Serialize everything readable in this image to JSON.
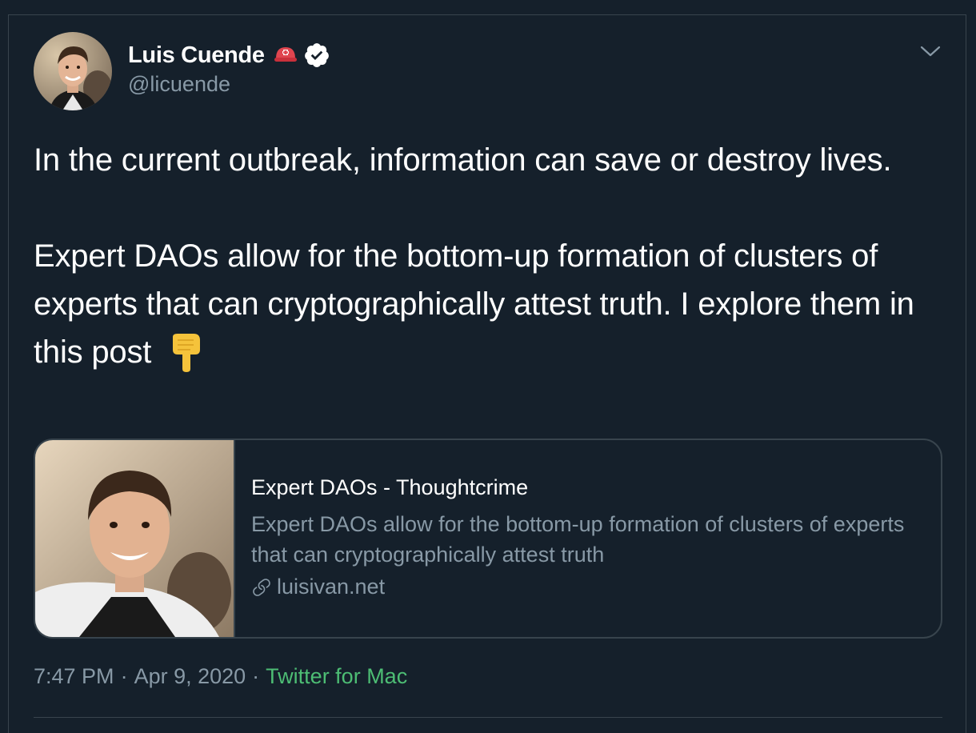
{
  "tweet": {
    "author": {
      "display_name": "Luis Cuende",
      "handle": "@licuende",
      "avatar_icon": "profile-photo",
      "badges": [
        "helmet-emoji-icon",
        "verified-badge-icon"
      ]
    },
    "text_paragraphs": [
      "In the current outbreak, information can save or destroy lives.",
      "Expert DAOs allow for the bottom-up formation of clusters of experts that can cryptographically attest truth. I explore them in this post"
    ],
    "text_emoji": "backhand-index-pointing-down-icon",
    "card": {
      "title": "Expert DAOs - Thoughtcrime",
      "description": "Expert DAOs allow for the bottom-up formation of clusters of experts that can cryptographically attest truth",
      "domain": "luisivan.net",
      "link_icon": "link-icon"
    },
    "meta": {
      "time": "7:47 PM",
      "separator": "·",
      "date": "Apr 9, 2020",
      "source": "Twitter for Mac"
    }
  },
  "colors": {
    "background": "#15202b",
    "border": "#38444d",
    "secondary_text": "#8899a6",
    "source_link": "#4dbd74"
  }
}
